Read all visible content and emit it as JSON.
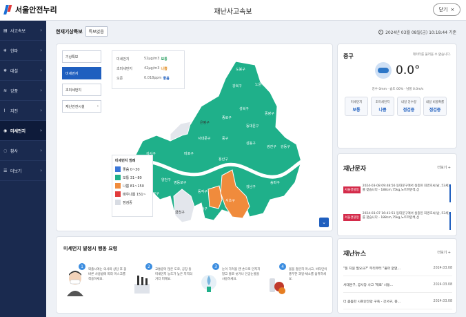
{
  "header": {
    "logo_text": "서울안전누리",
    "title": "재난사고속보",
    "close_label": "닫기",
    "close_icon": "×"
  },
  "sidebar": {
    "items": [
      {
        "label": "사고속보",
        "icon": "▤"
      },
      {
        "label": "한파",
        "icon": "❄"
      },
      {
        "label": "대설",
        "icon": "❅"
      },
      {
        "label": "강풍",
        "icon": "≋"
      },
      {
        "label": "지진",
        "icon": "⌇"
      },
      {
        "label": "미세먼지",
        "icon": "◉",
        "active": true
      },
      {
        "label": "황사",
        "icon": "◌"
      },
      {
        "label": "더보기",
        "icon": "☰"
      }
    ]
  },
  "status": {
    "title": "현재기상특보",
    "badge": "특보없음",
    "datetime": "2024년 03월 08일(금) 10:18:44 기준"
  },
  "map_panel": {
    "tabs": [
      "기상특보",
      "미세먼지",
      "초미세먼지",
      "재난안전시설"
    ],
    "active_tab": 1,
    "dust_info": [
      {
        "label": "미세먼지",
        "value": "52μg/m3",
        "level": "보통",
        "level_color": "#1f9a5a"
      },
      {
        "label": "초미세먼지",
        "value": "42μg/m3",
        "level": "나쁨",
        "level_color": "#e08a1e"
      },
      {
        "label": "오존",
        "value": "0.018ppm",
        "level": "좋음",
        "level_color": "#1f5fbf"
      }
    ],
    "legend_title": "미세먼지 범례",
    "legend": [
      {
        "label": "좋음 0~30",
        "color": "#3a76d8"
      },
      {
        "label": "보통 31~80",
        "color": "#1fb08a"
      },
      {
        "label": "나쁨 81~150",
        "color": "#f08b3c"
      },
      {
        "label": "매우나쁨 151~",
        "color": "#e23b3b"
      },
      {
        "label": "점검중",
        "color": "#d8dce3"
      }
    ],
    "districts": [
      "도봉구",
      "노원구",
      "강북구",
      "은평구",
      "성북구",
      "중랑구",
      "종로구",
      "동대문구",
      "서대문구",
      "강서구",
      "마포구",
      "중구",
      "성동구",
      "광진구",
      "강동구",
      "양천구",
      "용산구",
      "영등포구",
      "동작구",
      "서초구",
      "강남구",
      "송파구",
      "구로구",
      "관악구",
      "금천구"
    ]
  },
  "guide": {
    "title": "미세먼지 발생시 행동 요령",
    "steps": [
      {
        "num": "1",
        "text": "외출시에는 의사와 상담 후 올바른 사용법에 따라 마스크를 착용하세요."
      },
      {
        "num": "2",
        "text": "교통량이 많은 도로, 공장 등 미세먼지 농도가 높은 지역의 거리 피해요."
      },
      {
        "num": "3",
        "text": "눈이 가려울 땐 손으로 만지지 말고 물로 씻거나 인공눈물을 사용하세요."
      },
      {
        "num": "4",
        "text": "물을 충분히 마시고, 비타민이 풍부한 과일·채소를 섭취하세요."
      }
    ]
  },
  "weather": {
    "region": "중구",
    "note": "데이터를 불러올 수 없습니다.",
    "temp": "0.0°",
    "stats": "강수 0mm · 습도 00% · 남풍 0.0m/s",
    "pills": [
      {
        "label": "미세먼지",
        "value": "보통"
      },
      {
        "label": "초미세먼지",
        "value": "나쁨"
      },
      {
        "label": "내일 강수량",
        "value": "점검중"
      },
      {
        "label": "내일 비올확률",
        "value": "점검중"
      }
    ]
  },
  "disaster_msg": {
    "title": "재난문자",
    "more": "더보기 +",
    "items": [
      {
        "badge": "서울경찰청",
        "text": "2024-03-08 09:48:56 동대문구에서 실종된 최경호씨(남, 53세)를 찾습니다 - 188cm,75kg,노트파란색,상"
      },
      {
        "badge": "서울경찰청",
        "text": "2024-03-07 16:41:51 동대문구에서 실종된 최경호씨(남, 53세)를 찾습니다 - 188cm,75kg,노트파란색,상"
      }
    ]
  },
  "news": {
    "title": "재난뉴스",
    "more": "더보기 +",
    "items": [
      {
        "title": "\"돈 지원 필요요?\" 무리부터 \"둘마 없없...",
        "date": "2024.03.08"
      },
      {
        "title": "서대문구, 공사장 사고 '제로' 시동...",
        "date": "2024.03.08"
      },
      {
        "title": "더 촘촘한 사회안전망 구축 - 강서구, 중...",
        "date": "2024.03.08"
      }
    ]
  }
}
